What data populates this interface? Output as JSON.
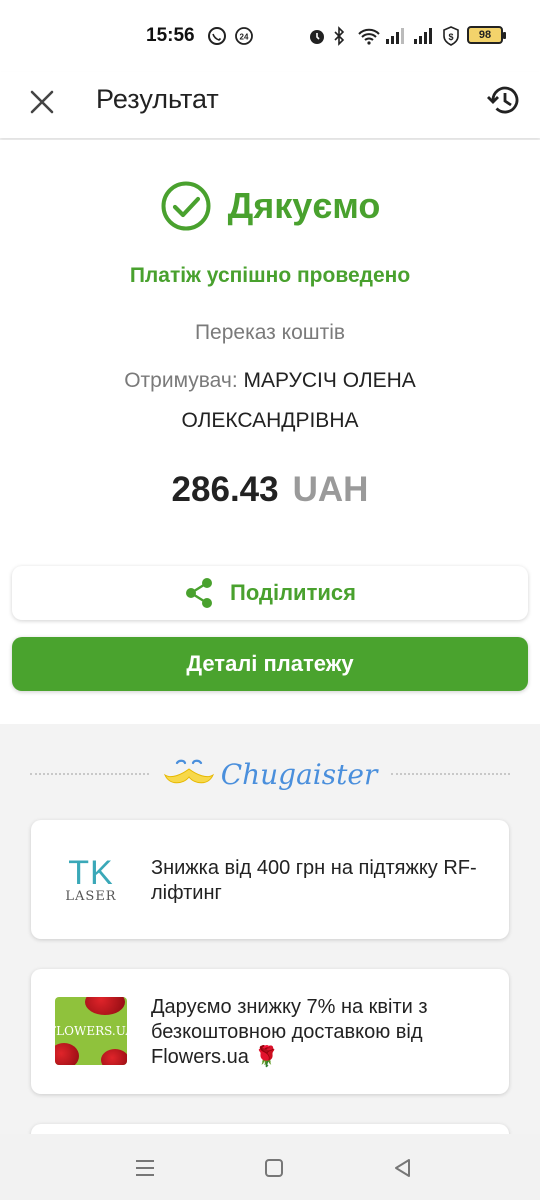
{
  "status_bar": {
    "time": "15:56",
    "battery": "98",
    "icons": [
      "viber-icon",
      "notification-24-icon",
      "alarm-icon",
      "bluetooth-icon",
      "wifi-icon",
      "signal-icon",
      "signal-icon",
      "security-shield-icon",
      "battery-icon"
    ]
  },
  "app_bar": {
    "title": "Результат",
    "close_icon": "close-icon",
    "history_icon": "history-icon"
  },
  "result": {
    "heading": "Дякуємо",
    "status": "Платіж успішно проведено",
    "transfer_type": "Переказ коштів",
    "recipient_label": "Отримувач:",
    "recipient_name": "МАРУСІЧ ОЛЕНА ОЛЕКСАНДРІВНА",
    "amount": "286.43",
    "currency": "UAH",
    "share_label": "Поділитися",
    "details_label": "Деталі платежу"
  },
  "chugaister": {
    "brand": "Chugaister",
    "offers": [
      {
        "logo_text": "TK",
        "logo_subtext": "LASER",
        "text": "Знижка від 400 грн на підтяжку RF-ліфтинг"
      },
      {
        "logo_text": "FLOWERS.UA",
        "text": "Даруємо знижку 7% на квіти з безкоштовною доставкою від Flowers.ua 🌹"
      }
    ]
  },
  "colors": {
    "accent_green": "#4aa32e",
    "text_green": "#49a12e",
    "brand_blue": "#4a8fdc"
  }
}
